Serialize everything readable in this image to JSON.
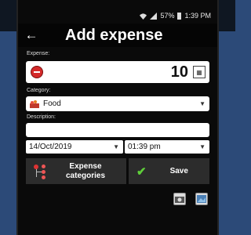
{
  "status": {
    "battery": "57%",
    "time": "1:39 PM"
  },
  "header": {
    "title": "Add expense"
  },
  "expense": {
    "label": "Expense:",
    "amount": "10"
  },
  "category": {
    "label": "Category:",
    "value": "Food"
  },
  "description": {
    "label": "Description:",
    "value": ""
  },
  "date": {
    "value": "14/Oct/2019"
  },
  "time": {
    "value": "01:39 pm"
  },
  "buttons": {
    "categories": "Expense categories",
    "save": "Save"
  },
  "icons": [
    "back-arrow-icon",
    "minus-icon",
    "calculator-icon",
    "food-icon",
    "categories-tree-icon",
    "check-icon",
    "camera-icon",
    "image-icon"
  ]
}
